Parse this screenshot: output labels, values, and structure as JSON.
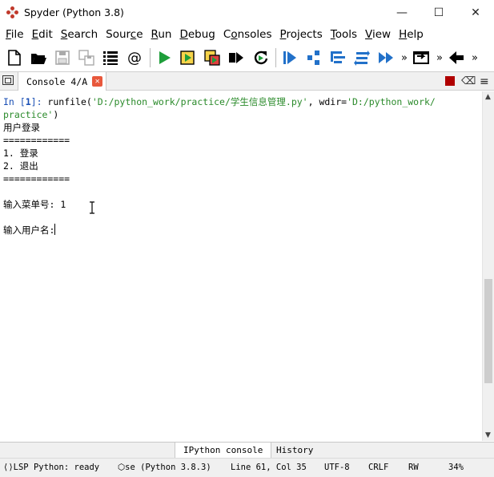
{
  "window": {
    "title": "Spyder (Python 3.8)",
    "minimize": "—",
    "maximize": "☐",
    "close": "✕"
  },
  "menu": [
    {
      "mnemonic": "F",
      "rest": "ile"
    },
    {
      "mnemonic": "E",
      "rest": "dit"
    },
    {
      "mnemonic": "S",
      "rest": "earch"
    },
    {
      "mnemonic": "",
      "pre": "Sour",
      "mn2": "c",
      "post": "e"
    },
    {
      "mnemonic": "R",
      "rest": "un"
    },
    {
      "mnemonic": "D",
      "rest": "ebug"
    },
    {
      "mnemonic": "",
      "pre": "C",
      "mn2": "o",
      "post": "nsoles"
    },
    {
      "mnemonic": "P",
      "rest": "rojects"
    },
    {
      "mnemonic": "T",
      "rest": "ools"
    },
    {
      "mnemonic": "V",
      "rest": "iew"
    },
    {
      "mnemonic": "H",
      "rest": "elp"
    }
  ],
  "toolbar": {
    "more": "»"
  },
  "console": {
    "tab_label": "Console 4/A",
    "tab_close": "✕",
    "prompt_prefix": "In [",
    "prompt_number": "1",
    "prompt_suffix": "]: ",
    "command_pre": "runfile(",
    "command_path": "'D:/python_work/practice/学生信息管理.py'",
    "command_mid": ", wdir=",
    "command_wdir_a": "'D:/python_work/",
    "command_wdir_b": "practice'",
    "command_end": ")",
    "output_lines": [
      "用户登录",
      "============",
      "1. 登录",
      "2. 退出",
      "============",
      "",
      "输入菜单号: 1",
      "",
      "输入用户名:"
    ]
  },
  "bottom_tabs": [
    "IPython console",
    "History"
  ],
  "status": {
    "lsp": "LSP Python: ready",
    "env": "se (Python 3.8.3)",
    "position": "Line 61, Col 35",
    "encoding": "UTF-8",
    "eol": "CRLF",
    "mode": "RW",
    "memory": "34%"
  }
}
